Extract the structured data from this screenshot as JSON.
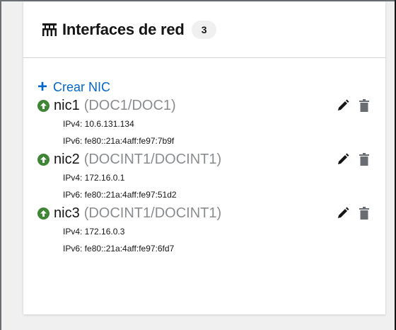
{
  "card": {
    "title": "Interfaces de red",
    "count": "3",
    "icon": "network-icon"
  },
  "create_label": "Crear NIC",
  "status_color": "#3e8635",
  "link_color": "#0066cc",
  "nics": [
    {
      "name": "nic1",
      "network": "(DOC1/DOC1)",
      "ipv4": "IPv4: 10.6.131.134",
      "ipv6": "IPv6: fe80::21a:4aff:fe97:7b9f"
    },
    {
      "name": "nic2",
      "network": "(DOCINT1/DOCINT1)",
      "ipv4": "IPv4: 172.16.0.1",
      "ipv6": "IPv6: fe80::21a:4aff:fe97:51d2"
    },
    {
      "name": "nic3",
      "network": "(DOCINT1/DOCINT1)",
      "ipv4": "IPv4: 172.16.0.3",
      "ipv6": "IPv6: fe80::21a:4aff:fe97:6fd7"
    }
  ]
}
